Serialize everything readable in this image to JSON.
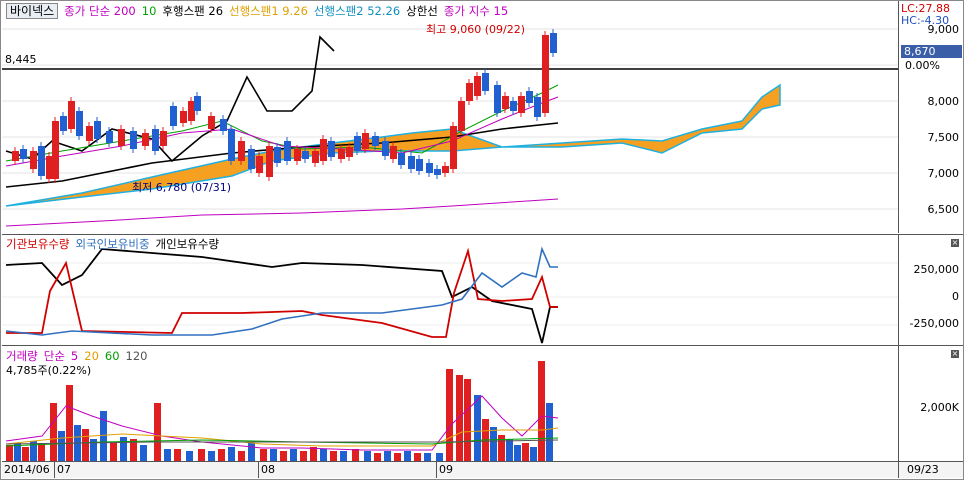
{
  "price_pane": {
    "stock_name": "바이넥스",
    "legend": [
      {
        "label": "종가 단순 200",
        "color": "#c000c0"
      },
      {
        "label": "10",
        "color": "#00a000"
      },
      {
        "label": "후행스팬 26",
        "color": "#000000"
      },
      {
        "label": "선행스팬1 9.26",
        "color": "#f0a000"
      },
      {
        "label": "선행스팬2 52.26",
        "color": "#1090c0"
      },
      {
        "label": "상한선",
        "color": "#000000"
      },
      {
        "label": "종가 지수 15",
        "color": "#c000c0"
      }
    ],
    "lc": "LC:27.88",
    "hc": "HC:-4.30",
    "ref_line_label": "8,445",
    "high_annotation": "최고 9,060 (09/22)",
    "low_annotation": "최저 6,780 (07/31)",
    "current_price": "8,670",
    "current_pct": "0.00%",
    "ticks": [
      "9,000",
      "8,500",
      "8,000",
      "7,500",
      "7,000",
      "6,500"
    ],
    "ticks_y": [
      9000,
      8500,
      8000,
      7500,
      7000,
      6500
    ]
  },
  "holding_pane": {
    "legend": [
      {
        "label": "기관보유수량",
        "color": "#d00000"
      },
      {
        "label": "외국인보유비중",
        "color": "#3070c0"
      },
      {
        "label": "개인보유수량",
        "color": "#000000"
      }
    ],
    "ticks": [
      "250,000",
      "0",
      "-250,000"
    ]
  },
  "volume_pane": {
    "legend": [
      {
        "label": "거래량",
        "color": "#c000c0"
      },
      {
        "label": "단순",
        "color": "#c000c0"
      },
      {
        "label": "5",
        "color": "#c000c0"
      },
      {
        "label": "20",
        "color": "#f0a000"
      },
      {
        "label": "60",
        "color": "#00a000"
      },
      {
        "label": "120",
        "color": "#555555"
      }
    ],
    "info": "4,785주(0.22%)",
    "ticks": [
      "2,000K"
    ]
  },
  "x_axis": {
    "labels": [
      "2014/06",
      "07",
      "08",
      "09"
    ],
    "right_label": "09/23"
  },
  "colors": {
    "up": "#e02020",
    "down": "#2060d0",
    "cloud_up": "#f5a020",
    "cloud_down": "#20b0e0"
  }
}
